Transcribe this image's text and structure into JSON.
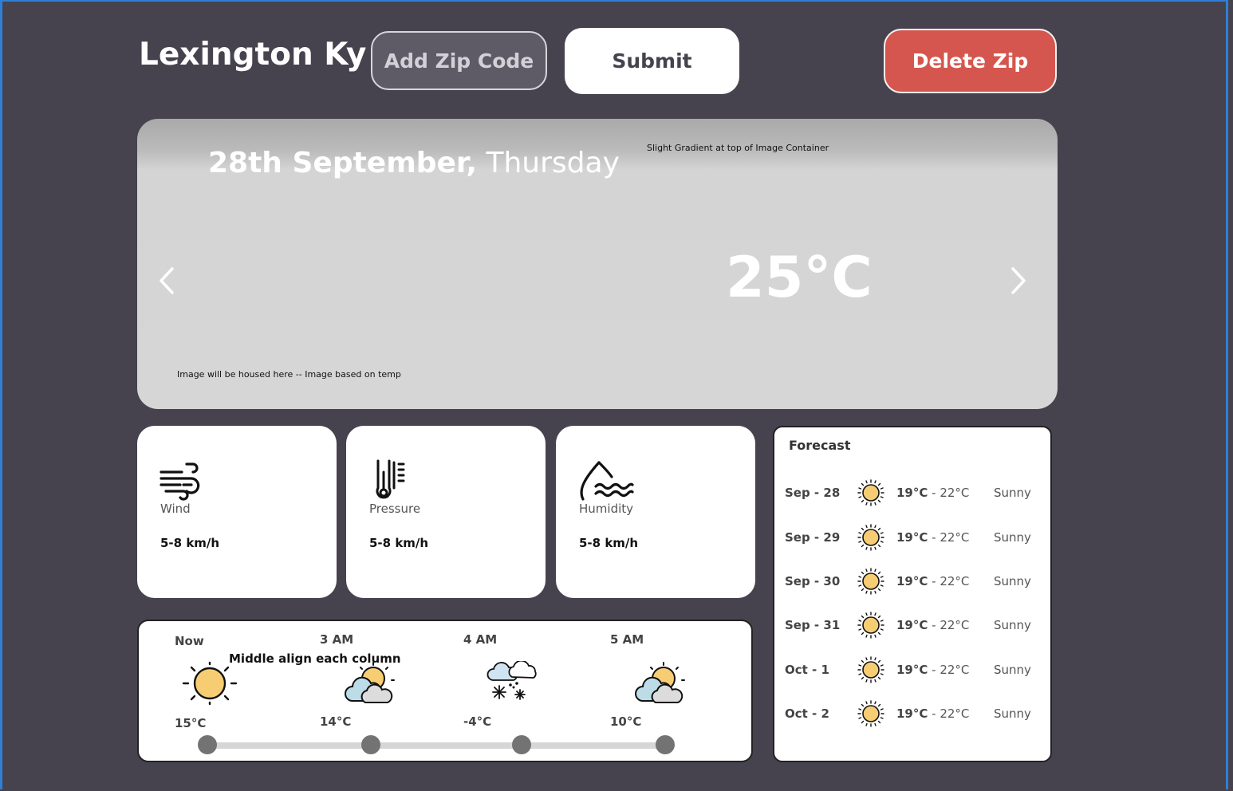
{
  "header": {
    "city": "Lexington Ky",
    "add_zip_label": "Add Zip Code",
    "submit_label": "Submit",
    "delete_label": "Delete Zip"
  },
  "hero": {
    "date_bold": "28th September,",
    "weekday": " Thursday",
    "gradient_note": "Slight Gradient at top of Image Container",
    "temperature": "25°C",
    "image_note": "Image will be housed here -- Image based on temp"
  },
  "stats": [
    {
      "label": "Wind",
      "value": "5-8 km/h",
      "icon": "wind-icon"
    },
    {
      "label": "Pressure",
      "value": "5-8 km/h",
      "icon": "thermometer-icon"
    },
    {
      "label": "Humidity",
      "value": "5-8 km/h",
      "icon": "humidity-icon"
    }
  ],
  "hourly": {
    "note": "Middle align each column",
    "items": [
      {
        "time": "Now",
        "temp": "15°C",
        "icon": "sun-icon"
      },
      {
        "time": "3 AM",
        "temp": "14°C",
        "icon": "partly-cloudy-icon"
      },
      {
        "time": "4 AM",
        "temp": "-4°C",
        "icon": "snow-cloud-icon"
      },
      {
        "time": "5 AM",
        "temp": "10°C",
        "icon": "partly-cloudy-icon"
      }
    ]
  },
  "forecast": {
    "title": "Forecast",
    "rows": [
      {
        "date": "Sep - 28",
        "low": "19°C",
        "high": " - 22°C",
        "desc": "Sunny"
      },
      {
        "date": "Sep - 29",
        "low": "19°C",
        "high": " - 22°C",
        "desc": "Sunny"
      },
      {
        "date": "Sep - 30",
        "low": "19°C",
        "high": " - 22°C",
        "desc": "Sunny"
      },
      {
        "date": "Sep - 31",
        "low": "19°C",
        "high": " - 22°C",
        "desc": "Sunny"
      },
      {
        "date": "Oct - 1",
        "low": "19°C",
        "high": " - 22°C",
        "desc": "Sunny"
      },
      {
        "date": "Oct - 2",
        "low": "19°C",
        "high": " - 22°C",
        "desc": "Sunny"
      }
    ]
  },
  "colors": {
    "background": "#46434e",
    "delete": "#d5564e",
    "sun": "#f7cd74",
    "frame": "#2f7fd6"
  }
}
